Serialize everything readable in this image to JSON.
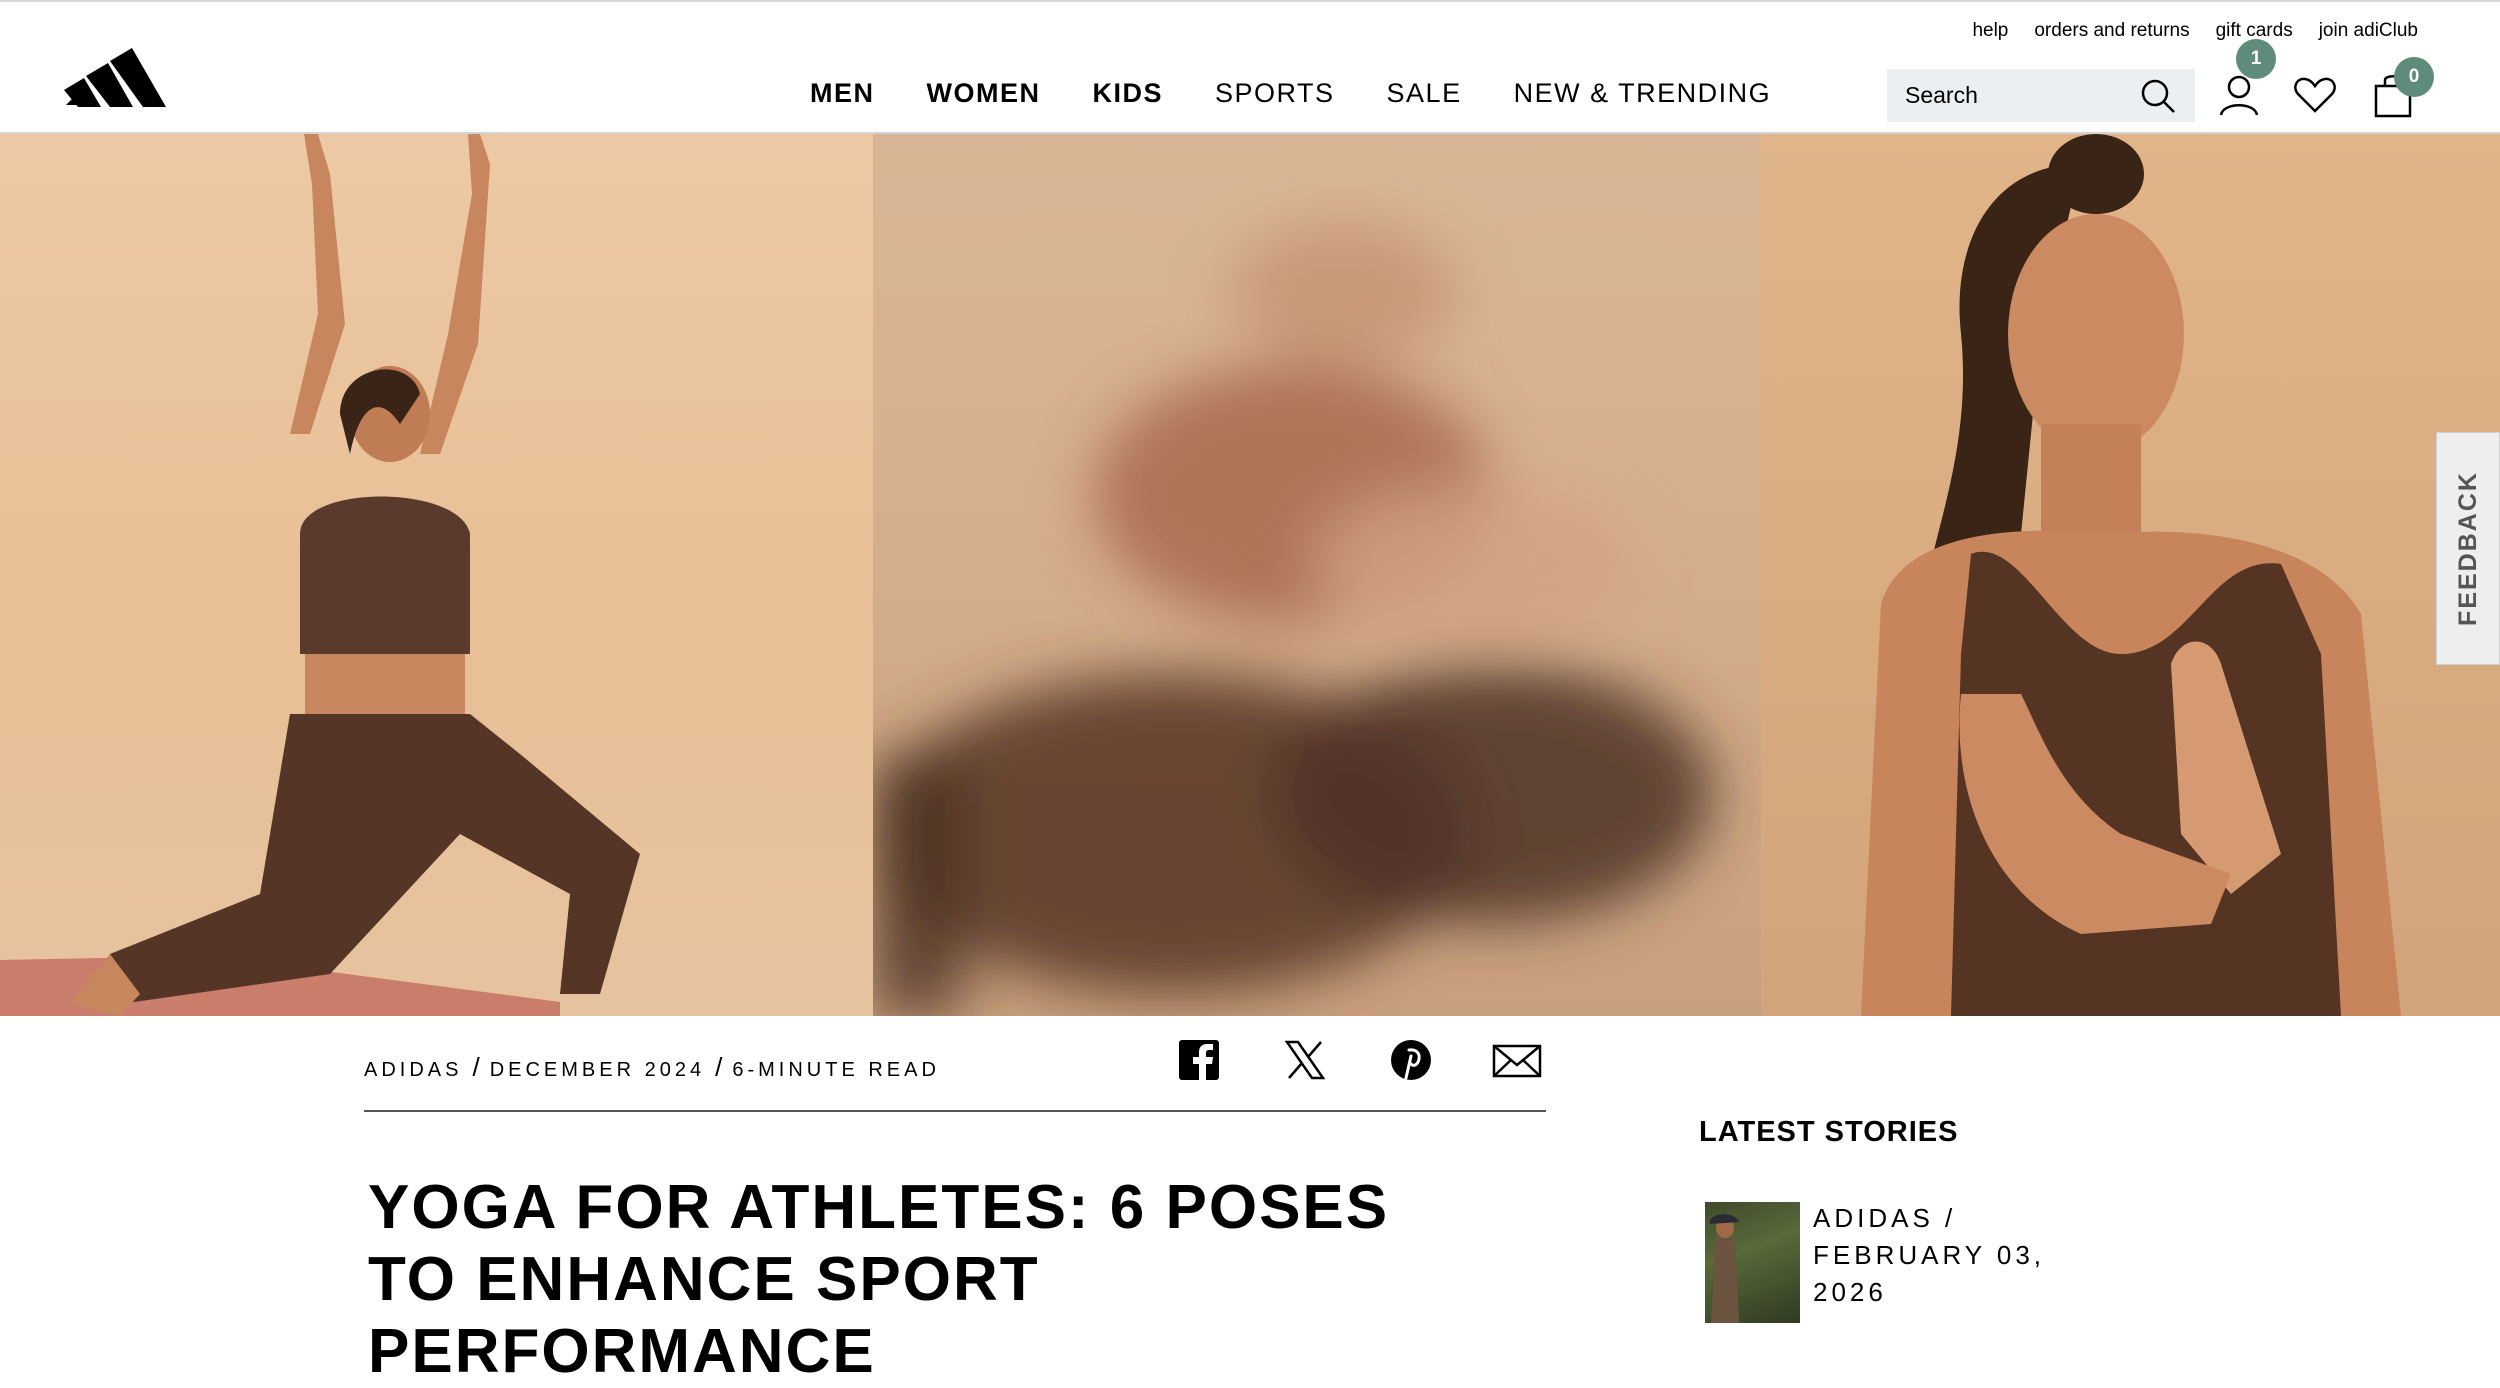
{
  "utility_nav": [
    "help",
    "orders and returns",
    "gift cards",
    "join adiClub"
  ],
  "main_nav": [
    {
      "label": "MEN",
      "bold": true
    },
    {
      "label": "WOMEN",
      "bold": true
    },
    {
      "label": "KIDS",
      "bold": true
    },
    {
      "label": "SPORTS",
      "bold": false
    },
    {
      "label": "SALE",
      "bold": false
    },
    {
      "label": "NEW & TRENDING",
      "bold": false
    }
  ],
  "search": {
    "placeholder": "Search"
  },
  "account": {
    "badge": "1"
  },
  "bag": {
    "badge": "0"
  },
  "accent_color": "#5e8b7a",
  "hero": {
    "panels": 3
  },
  "feedback": {
    "label": "FEEDBACK"
  },
  "article": {
    "meta": {
      "author": "ADIDAS",
      "date": "DECEMBER 2024",
      "read_time": "6-MINUTE READ",
      "separator": "/"
    },
    "share": [
      "facebook-icon",
      "x-icon",
      "pinterest-icon",
      "email-icon"
    ],
    "title": "YOGA FOR ATHLETES: 6 POSES TO ENHANCE SPORT PERFORMANCE"
  },
  "sidebar": {
    "heading": "LATEST STORIES",
    "stories": [
      {
        "meta": "ADIDAS / FEBRUARY 03, 2026"
      }
    ]
  }
}
